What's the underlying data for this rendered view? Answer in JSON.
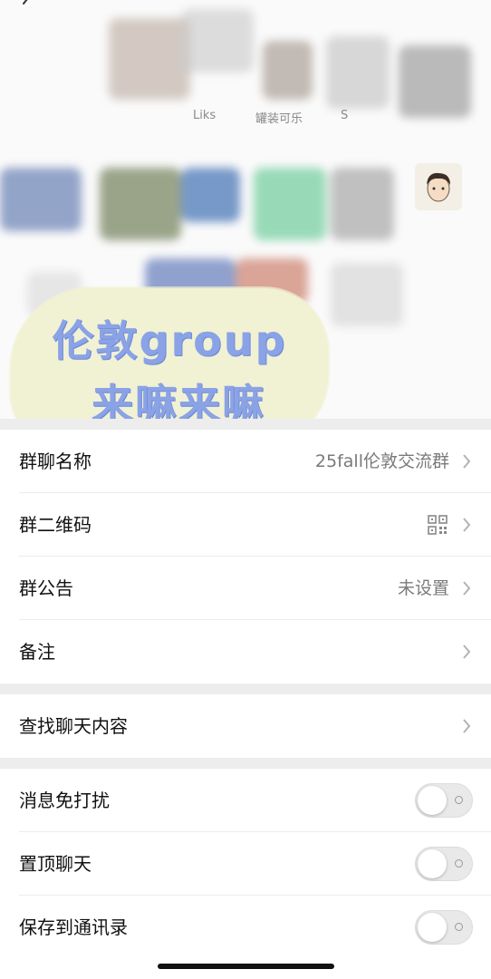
{
  "header": {
    "member_names": [
      "Liks",
      "罐装可乐",
      "S"
    ]
  },
  "sticker": {
    "line1": "伦敦group",
    "line2": "来嘛来嘛"
  },
  "settings": {
    "group_name": {
      "label": "群聊名称",
      "value": "25fall伦敦交流群"
    },
    "qr_code": {
      "label": "群二维码"
    },
    "announcement": {
      "label": "群公告",
      "value": "未设置"
    },
    "remark": {
      "label": "备注"
    },
    "search_history": {
      "label": "查找聊天内容"
    },
    "mute": {
      "label": "消息免打扰",
      "on": false
    },
    "pin": {
      "label": "置顶聊天",
      "on": false
    },
    "save_contacts": {
      "label": "保存到通讯录",
      "on": false
    }
  },
  "colors": {
    "background": "#ffffff",
    "section_gap": "#ededed",
    "sticker_bg": "#f1f1d4",
    "sticker_text": "#8aa3e6",
    "toggle_off": "#e9e9e9"
  }
}
